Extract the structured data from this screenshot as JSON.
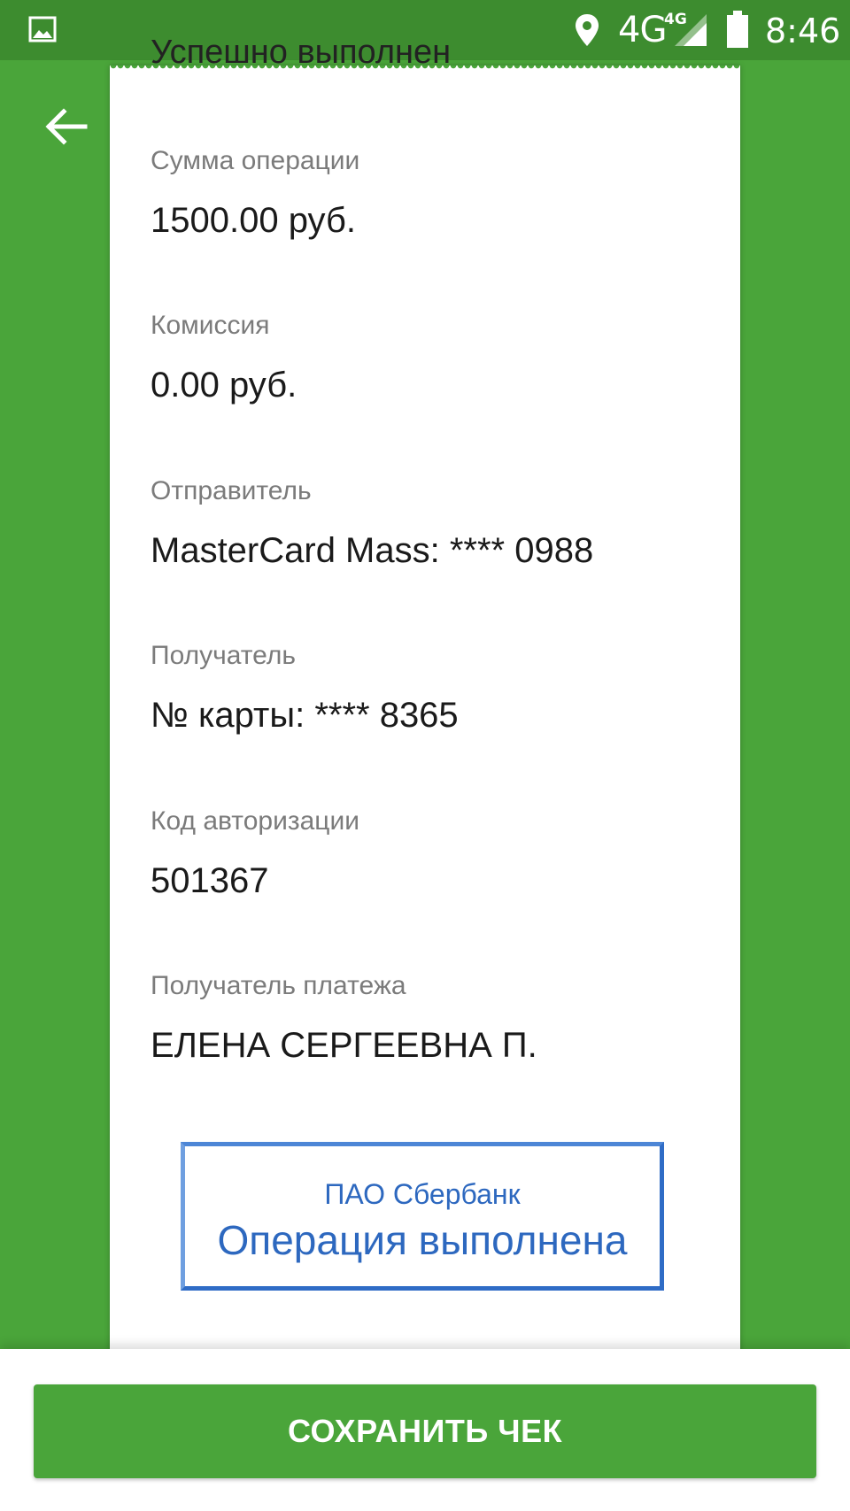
{
  "status_bar": {
    "network": "4G",
    "network_sup": "4G",
    "time": "8:46",
    "icons": [
      "gallery-icon",
      "location-icon",
      "signal-icon",
      "battery-icon"
    ]
  },
  "navigation": {
    "back_icon": "arrow-left-icon"
  },
  "receipt": {
    "partial_top_text": "Успешно выполнен",
    "fields": [
      {
        "label": "Сумма операции",
        "value": "1500.00 руб."
      },
      {
        "label": "Комиссия",
        "value": "0.00 руб."
      },
      {
        "label": "Отправитель",
        "value": "MasterCard Mass: **** 0988"
      },
      {
        "label": "Получатель",
        "value": "№ карты: **** 8365"
      },
      {
        "label": "Код авторизации",
        "value": "501367"
      },
      {
        "label": "Получатель платежа",
        "value": "ЕЛЕНА СЕРГЕЕВНА П."
      }
    ],
    "stamp": {
      "organization": "ПАО Сбербанк",
      "status": "Операция выполнена"
    }
  },
  "actions": {
    "save_label": "СОХРАНИТЬ ЧЕК"
  },
  "colors": {
    "brand_green": "#4aa53a",
    "status_bar_green": "#3d8c2f",
    "stamp_blue": "#2d68bf"
  }
}
